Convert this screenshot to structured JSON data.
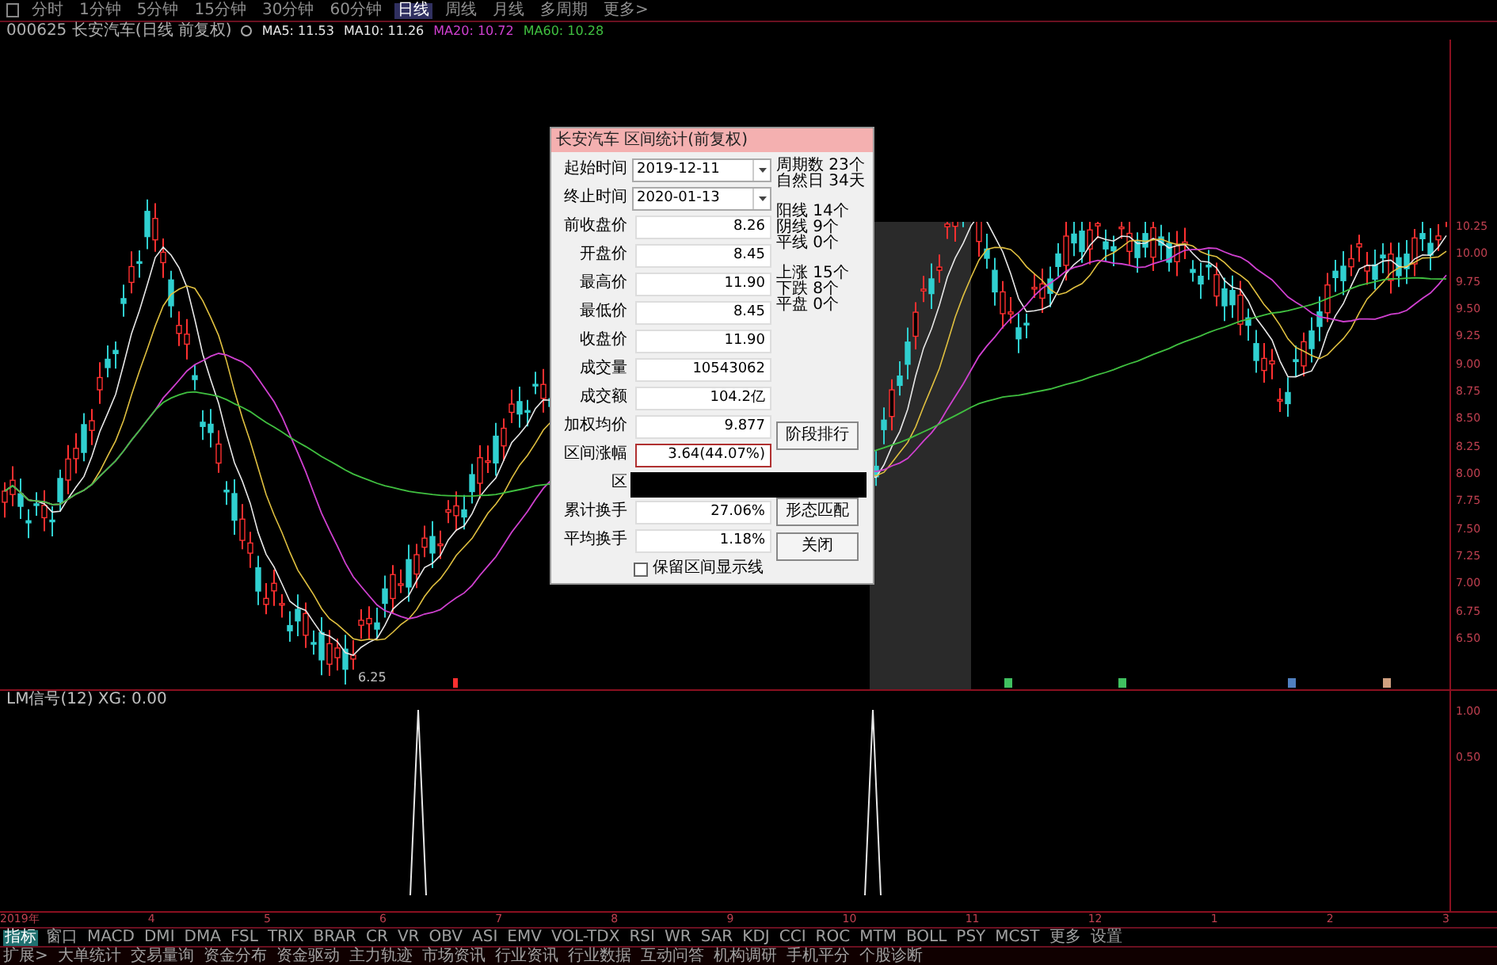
{
  "period_bar": [
    {
      "label": "分时",
      "selected": false
    },
    {
      "label": "1分钟",
      "selected": false
    },
    {
      "label": "5分钟",
      "selected": false
    },
    {
      "label": "15分钟",
      "selected": false
    },
    {
      "label": "30分钟",
      "selected": false
    },
    {
      "label": "60分钟",
      "selected": false
    },
    {
      "label": "日线",
      "selected": true
    },
    {
      "label": "周线",
      "selected": false
    },
    {
      "label": "月线",
      "selected": false
    },
    {
      "label": "多周期",
      "selected": false
    },
    {
      "label": "更多>",
      "selected": false
    }
  ],
  "info_line": {
    "title": "000625 长安汽车(日线 前复权)",
    "ma": [
      {
        "label": "MA5: 11.53",
        "color": "#e8e8e8"
      },
      {
        "label": "MA10: 11.26",
        "color": "#e8e8e8"
      },
      {
        "label": "MA20: 10.72",
        "color": "#d040d0"
      },
      {
        "label": "MA60: 10.28",
        "color": "#40c040"
      }
    ]
  },
  "y_axis": [
    "10.25",
    "10.00",
    "9.75",
    "9.50",
    "9.25",
    "9.00",
    "8.75",
    "8.50",
    "8.25",
    "8.00",
    "7.75",
    "7.50",
    "7.25",
    "7.00",
    "6.75",
    "6.50"
  ],
  "low_label": "6.25",
  "dialog": {
    "title": "长安汽车 区间统计(前复权)",
    "dates": [
      {
        "label": "起始时间",
        "value": "2019-12-11"
      },
      {
        "label": "终止时间",
        "value": "2020-01-13"
      }
    ],
    "rows": [
      {
        "label": "前收盘价",
        "value": "8.26",
        "highlighted": false
      },
      {
        "label": "开盘价",
        "value": "8.45",
        "highlighted": false
      },
      {
        "label": "最高价",
        "value": "11.90",
        "highlighted": false
      },
      {
        "label": "最低价",
        "value": "8.45",
        "highlighted": false
      },
      {
        "label": "收盘价",
        "value": "11.90",
        "highlighted": false
      },
      {
        "label": "成交量",
        "value": "10543062",
        "highlighted": false
      },
      {
        "label": "成交额",
        "value": "104.2亿",
        "highlighted": false
      },
      {
        "label": "加权均价",
        "value": "9.877",
        "highlighted": false
      },
      {
        "label": "区间涨幅",
        "value": "3.64(44.07%)",
        "highlighted": true
      },
      {
        "label": "区"
      },
      {
        "label": "累计换手",
        "value": "27.06%",
        "highlighted": false
      },
      {
        "label": "平均换手",
        "value": "1.18%",
        "highlighted": false
      }
    ],
    "stats": [
      [
        "周期数 23个",
        "自然日 34天"
      ],
      [
        "阳线 14个",
        "阴线 9个",
        "平线 0个"
      ],
      [
        "上涨 15个",
        "下跌 8个",
        "平盘 0个"
      ]
    ],
    "buttons": [
      "阶段排行",
      "形态匹配",
      "关闭"
    ],
    "checkbox": {
      "label": "保留区间显示线",
      "checked": false
    }
  },
  "indicator": {
    "title": "LM信号(12) XG: 0.00",
    "y_axis": [
      "1.00",
      "0.50"
    ]
  },
  "x_axis": [
    "2019年",
    "4",
    "5",
    "6",
    "7",
    "8",
    "9",
    "10",
    "11",
    "12",
    "1",
    "2",
    "3"
  ],
  "indicator_tabs": [
    {
      "label": "指标",
      "selected": true
    },
    {
      "label": "窗口",
      "selected": false
    },
    {
      "label": "MACD",
      "selected": false
    },
    {
      "label": "DMI",
      "selected": false
    },
    {
      "label": "DMA",
      "selected": false
    },
    {
      "label": "FSL",
      "selected": false
    },
    {
      "label": "TRIX",
      "selected": false
    },
    {
      "label": "BRAR",
      "selected": false
    },
    {
      "label": "CR",
      "selected": false
    },
    {
      "label": "VR",
      "selected": false
    },
    {
      "label": "OBV",
      "selected": false
    },
    {
      "label": "ASI",
      "selected": false
    },
    {
      "label": "EMV",
      "selected": false
    },
    {
      "label": "VOL-TDX",
      "selected": false
    },
    {
      "label": "RSI",
      "selected": false
    },
    {
      "label": "WR",
      "selected": false
    },
    {
      "label": "SAR",
      "selected": false
    },
    {
      "label": "KDJ",
      "selected": false
    },
    {
      "label": "CCI",
      "selected": false
    },
    {
      "label": "ROC",
      "selected": false
    },
    {
      "label": "MTM",
      "selected": false
    },
    {
      "label": "BOLL",
      "selected": false
    },
    {
      "label": "PSY",
      "selected": false
    },
    {
      "label": "MCST",
      "selected": false
    },
    {
      "label": "更多",
      "selected": false
    },
    {
      "label": "设置",
      "selected": false
    }
  ],
  "extension_tabs": [
    "扩展>",
    "大单统计",
    "交易量询",
    "资金分布",
    "资金驱动",
    "主力轨迹",
    "市场资讯",
    "行业资讯",
    "行业数据",
    "互动问答",
    "机构调研",
    "手机平分",
    "个股诊断"
  ]
}
